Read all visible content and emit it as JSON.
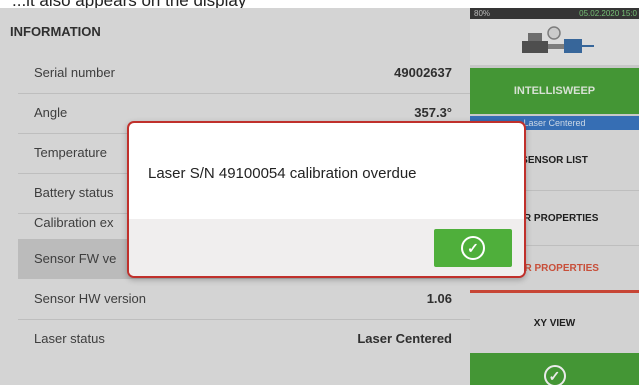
{
  "page_heading": "...it also appears on the display",
  "info": {
    "title": "INFORMATION",
    "rows": [
      {
        "label": "Serial number",
        "value": "49002637"
      },
      {
        "label": "Angle",
        "value": "357.3°"
      },
      {
        "label": "Temperature",
        "value": ""
      },
      {
        "label": "Battery status",
        "value": ""
      },
      {
        "label": "Calibration ex",
        "value": ""
      },
      {
        "label": "Sensor FW ve",
        "value": ""
      },
      {
        "label": "Sensor HW version",
        "value": "1.06"
      },
      {
        "label": "Laser status",
        "value": "Laser Centered"
      }
    ]
  },
  "status_bar": {
    "battery": "80%",
    "date": "05.02.2020 15:0"
  },
  "side": {
    "intellisweep": "INTELLISWEEP",
    "laser_centered": "Laser Centered",
    "sensor_list": "SENSOR LIST",
    "user_properties": "SER PROPERTIES",
    "sensor_properties": "SOR PROPERTIES",
    "xy_view": "XY VIEW",
    "confirm_icon": "checkmark-circle-icon"
  },
  "dialog": {
    "message": "Laser S/N 49100054 calibration overdue",
    "ok_icon": "checkmark-circle-icon"
  },
  "colors": {
    "accent_green": "#4aa33a",
    "dialog_border": "#c0302b",
    "laser_blue": "#3b78c4",
    "sensor_props_red": "#d84b3a"
  }
}
